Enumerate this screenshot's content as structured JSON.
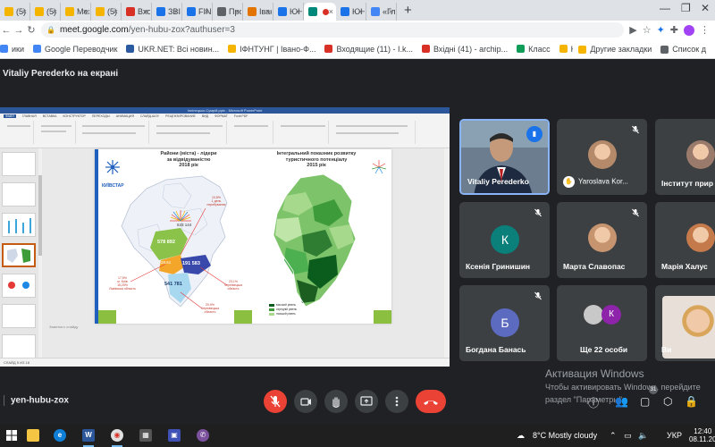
{
  "browser": {
    "tabs": [
      {
        "label": "(5)",
        "color": "#f4b400"
      },
      {
        "label": "(5)",
        "color": "#f4b400"
      },
      {
        "label": "Мех",
        "color": "#f4b400"
      },
      {
        "label": "(5)",
        "color": "#f4b400"
      },
      {
        "label": "Вхо",
        "color": "#d93025"
      },
      {
        "label": "ЗВІ",
        "color": "#1a73e8"
      },
      {
        "label": "FIN",
        "color": "#1a73e8"
      },
      {
        "label": "Про",
        "color": "#5f6368"
      },
      {
        "label": "Іван",
        "color": "#e37400"
      },
      {
        "label": "ЮН",
        "color": "#1a73e8"
      },
      {
        "label": "",
        "color": "#00897b",
        "active": true
      },
      {
        "label": "ЮН",
        "color": "#1a73e8"
      },
      {
        "label": "«Гл",
        "color": "#4285f4"
      }
    ],
    "url_host": "meet.google.com",
    "url_path": "/yen-hubu-zox?authuser=3"
  },
  "bookmarks": {
    "items": [
      {
        "label": "ики",
        "color": "#4285f4"
      },
      {
        "label": "Google Переводчик",
        "color": "#4285f4"
      },
      {
        "label": "UKR.NET: Всі новин...",
        "color": "#2c5aa0"
      },
      {
        "label": "ІФНТУНГ | Івано-Ф...",
        "color": "#f4b400"
      },
      {
        "label": "Входящие (11) - I.k...",
        "color": "#d93025"
      },
      {
        "label": "Вхідні (41) - archip...",
        "color": "#d93025"
      },
      {
        "label": "Класс",
        "color": "#0f9d58"
      },
      {
        "label": "Курсы",
        "color": "#f4b400"
      }
    ],
    "other": "Другие закладки",
    "reading": "Список д"
  },
  "meet": {
    "presenter_banner": "Vitaliy Perederko на екрані",
    "meeting_code": "yen-hubu-zox"
  },
  "presentation": {
    "window_title": "Іллінецько-Сумрій.pptx - Microsoft PowerPoint",
    "ribbon_tabs": [
      "ФАЙЛ",
      "ГЛАВНАЯ",
      "ВСТАВКА",
      "КОНСТРУКТОР",
      "ПЕРЕХОДЫ",
      "АНИМАЦИЯ",
      "СЛАЙД-ШОУ",
      "РЕЦЕНЗИРОВАНИЕ",
      "ВИД",
      "ФОРМАТ",
      "Foxit PDF"
    ],
    "notes_hint": "Заметки к слайду",
    "status": "СЛАЙД 5 ИЗ 18",
    "slide": {
      "logo": "КИЇВСТАР",
      "left_title": "Райони (міста) - лідери\nза відвідуваністю\n2018 рік",
      "right_title": "Інтегральний показник розвитку\nтуристичного потенціалу\n2015 рік",
      "values": {
        "v1": "533 144",
        "v2": "578 892",
        "v3": "191 583",
        "v4": "541 781",
        "v5": "28,51"
      },
      "notes": {
        "n1": "10,8%\n1 день\nперебування",
        "n2": "17,5%\nм. Київ\n15,25%\nЛьвівська область",
        "n3": "23,1%\nЧернівецька\nобласть",
        "n4": "20,9%\nЧернівецька\nобласть"
      },
      "legend": [
        "високий рівень",
        "середній рівень",
        "низький рівень"
      ],
      "legend_colors": [
        "#0b5d1e",
        "#3e9b3a",
        "#a6d98c"
      ]
    }
  },
  "participants": [
    {
      "name": "Vitaliy Perederko",
      "type": "video",
      "speaking": true
    },
    {
      "name": "Yaroslava Kor...",
      "type": "photo",
      "hand": true,
      "muted": true
    },
    {
      "name": "Інститут прир",
      "type": "photo"
    },
    {
      "name": "Ксенія Гринишин",
      "type": "initial",
      "initial": "К",
      "color": "#0b7f7a",
      "muted": true
    },
    {
      "name": "Марта Славопас",
      "type": "photo",
      "muted": true
    },
    {
      "name": "Марія Халус",
      "type": "photo"
    },
    {
      "name": "Богдана Банась",
      "type": "initial",
      "initial": "Б",
      "color": "#5c6bc0",
      "muted": true
    },
    {
      "name": "Ще 22 особи",
      "type": "others",
      "initial": "К",
      "color": "#8e24aa"
    },
    {
      "name": "Ви",
      "type": "photo"
    }
  ],
  "windows_activation": {
    "line1": "Активация Windows",
    "line2": "Чтобы активировать Windows, перейдите",
    "line3": "раздел \"Параметры\"."
  },
  "controls": {
    "mic": "mic-off",
    "camera": "camera",
    "hand": "raise-hand",
    "present": "present",
    "more": "more",
    "end": "end-call",
    "people_count": "31"
  },
  "taskbar": {
    "weather": "8°C  Mostly cloudy",
    "lang": "УКР",
    "time": "12:40",
    "date": "08.11.20"
  }
}
